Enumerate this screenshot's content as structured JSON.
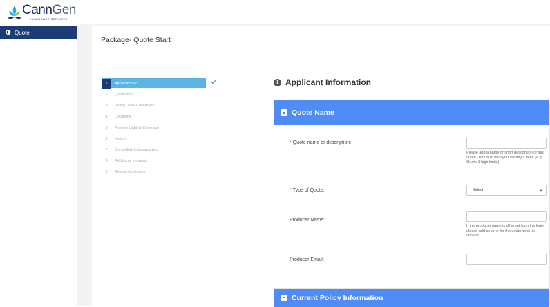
{
  "brand": {
    "name_part1": "Cann",
    "name_part2": "Gen",
    "subtitle": "INSURANCE SERVICES",
    "leaf_color": "#27a9e1",
    "leaf_accent": "#8dc63f"
  },
  "sidebar": {
    "items": [
      {
        "label": "Quote",
        "icon": "shield-icon"
      }
    ]
  },
  "page": {
    "title": "Package- Quote Start"
  },
  "steps": [
    {
      "num": "1",
      "label": "Applicant Info",
      "active": true,
      "complete": true
    },
    {
      "num": "2",
      "label": "Quote Info"
    },
    {
      "num": "3",
      "label": "Policy Level Coverages"
    },
    {
      "num": "4",
      "label": "Locations"
    },
    {
      "num": "5",
      "label": "Product Liability Coverage"
    },
    {
      "num": "6",
      "label": "History"
    },
    {
      "num": "7",
      "label": "Controlled Substance Act"
    },
    {
      "num": "8",
      "label": "Additional Interests"
    },
    {
      "num": "9",
      "label": "Review Application"
    }
  ],
  "main": {
    "heading": "Applicant Information",
    "quote_name_panel": {
      "title": "Quote Name",
      "fields": {
        "quote_name": {
          "label": "Quote name or description:",
          "required_mark": "*",
          "value": "",
          "help": "Please add a name or short description of this quote. This is to help you identify it later. (e.g. Quote 1 high limits)"
        },
        "quote_type": {
          "label": "Type of Quote:",
          "required_mark": "*",
          "selected": "Select"
        },
        "producer_name": {
          "label": "Producer Name:",
          "value": "",
          "help": "If the producer name is different form the login please add a name for the underwriter to contact."
        },
        "producer_email": {
          "label": "Producer Email:",
          "value": ""
        }
      }
    },
    "current_policy_panel": {
      "title": "Current Policy Information"
    }
  },
  "colors": {
    "nav_active": "#1d3b74",
    "step_active": "#5ab4e6",
    "panel_header": "#4f8cf5",
    "check": "#4caf50",
    "required": "#d9534f"
  }
}
